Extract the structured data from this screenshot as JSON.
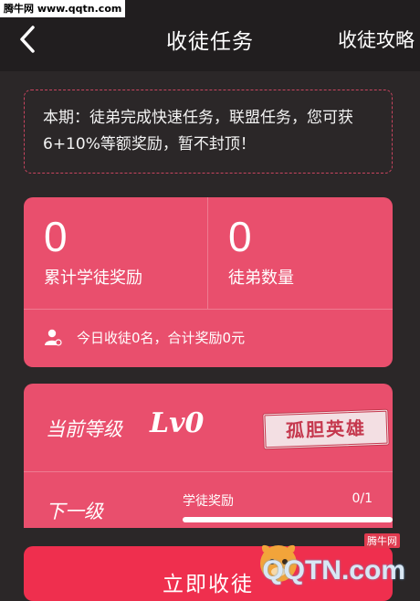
{
  "watermark_top": "腾牛网 www.qqtn.com",
  "nav": {
    "back_icon": "chevron-left-icon",
    "title": "收徒任务",
    "action": "收徒攻略"
  },
  "notice": {
    "text": "本期：徒弟完成快速任务，联盟任务，您可获6+10%等额奖励，暂不封顶！"
  },
  "stats": {
    "reward_value": "0",
    "reward_label": "累计学徒奖励",
    "disciples_value": "0",
    "disciples_label": "徒弟数量",
    "today_icon": "user-icon",
    "today_text": "今日收徒0名，合计奖励0元"
  },
  "level": {
    "current_label": "当前等级",
    "current_value": "Lv0",
    "badge_text": "孤胆英雄",
    "next_label": "下一级",
    "progress_label": "学徒奖励",
    "progress_count": "0/1",
    "progress_fraction": 0
  },
  "cta": {
    "label": "立即收徒"
  },
  "watermark_br": {
    "brand": "腾牛网",
    "text": "QQTN.com",
    "logo_icon": "bull-logo-icon"
  },
  "colors": {
    "card": "#e94f6d",
    "cta": "#ef2f4e",
    "background": "#2b2728",
    "navbar": "#211e1f"
  }
}
